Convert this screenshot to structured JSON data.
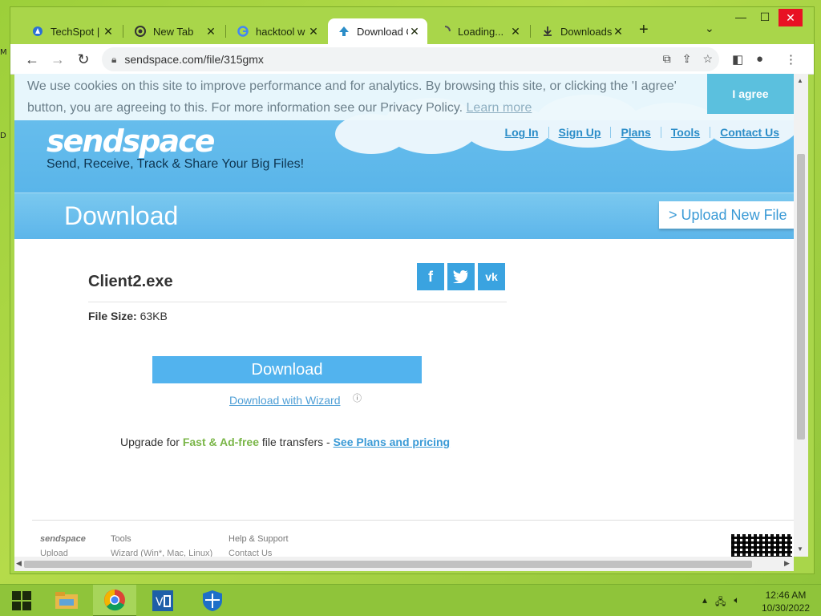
{
  "tabs": [
    {
      "label": "TechSpot | T",
      "icon": "techspot-icon"
    },
    {
      "label": "New Tab",
      "icon": "chrome-icon"
    },
    {
      "label": "hacktool w",
      "icon": "google-icon"
    },
    {
      "label": "Download C",
      "icon": "sendspace-icon"
    },
    {
      "label": "Loading...",
      "icon": "loading-spinner-icon"
    },
    {
      "label": "Downloads",
      "icon": "download-icon"
    }
  ],
  "address": {
    "url": "sendspace.com/file/315gmx"
  },
  "cookie": {
    "text": "We use cookies on this site to improve performance and for analytics. By browsing this site, or clicking the 'I agree' button, you are agreeing to this. For more information see our Privacy Policy.",
    "learn_more": "Learn more",
    "agree": "I agree"
  },
  "header": {
    "logo": "sendspace",
    "tagline": "Send, Receive, Track & Share Your Big Files!",
    "nav": [
      "Log In",
      "Sign Up",
      "Plans",
      "Tools",
      "Contact Us"
    ],
    "title": "Download",
    "upload_new": "> Upload New File"
  },
  "file": {
    "name": "Client2.exe",
    "size_label": "File Size:",
    "size_value": "63KB"
  },
  "actions": {
    "download": "Download",
    "wizard": "Download with Wizard"
  },
  "upgrade": {
    "prefix": "Upgrade for",
    "highlight": "Fast & Ad-free",
    "middle": "file transfers -",
    "link": "See Plans and pricing"
  },
  "footer": {
    "col1_head": "sendspace",
    "col1_item": "Upload",
    "col2_head": "Tools",
    "col2_item": "Wizard (Win*, Mac, Linux)",
    "col3_head": "Help & Support",
    "col3_item": "Contact Us"
  },
  "taskbar": {
    "time": "12:46 AM",
    "date": "10/30/2022"
  },
  "colors": {
    "accent": "#52b3ee",
    "chrome_frame": "#a9d64a",
    "desktop": "#9ccf3a"
  }
}
